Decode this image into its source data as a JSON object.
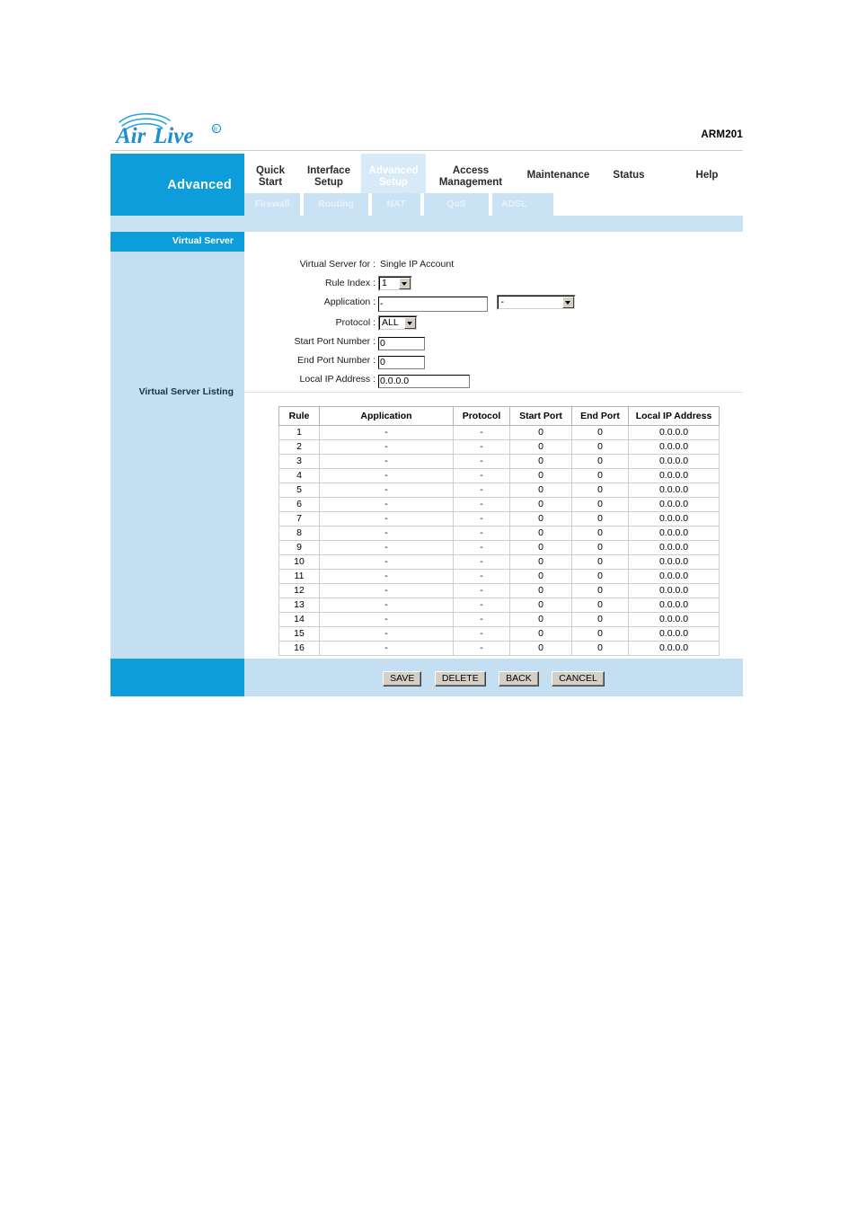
{
  "header": {
    "brand": "AirLive",
    "brand_mark": "®",
    "model": "ARM201"
  },
  "sidebar": {
    "section_title": "Advanced",
    "active_item": "Virtual Server",
    "listing_label": "Virtual Server Listing"
  },
  "nav": {
    "main_tabs": [
      {
        "label": "Quick\nStart",
        "active": false
      },
      {
        "label": "Interface\nSetup",
        "active": false
      },
      {
        "label": "Advanced\nSetup",
        "active": true
      },
      {
        "label": "Access\nManagement",
        "active": false
      },
      {
        "label": "Maintenance",
        "active": false
      },
      {
        "label": "Status",
        "active": false
      },
      {
        "label": "Help",
        "active": false
      }
    ],
    "sub_tabs": [
      {
        "label": "Firewall"
      },
      {
        "label": "Routing"
      },
      {
        "label": "NAT"
      },
      {
        "label": "QoS"
      },
      {
        "label": "ADSL"
      }
    ]
  },
  "form": {
    "virtual_server_for_label": "Virtual Server for :",
    "virtual_server_for_value": "Single IP Account",
    "rule_index_label": "Rule Index :",
    "rule_index_value": "1",
    "application_label": "Application :",
    "application_value": "-",
    "application_select_value": "-",
    "protocol_label": "Protocol :",
    "protocol_value": "ALL",
    "start_port_label": "Start Port Number :",
    "start_port_value": "0",
    "end_port_label": "End Port Number :",
    "end_port_value": "0",
    "local_ip_label": "Local IP Address :",
    "local_ip_value": "0.0.0.0"
  },
  "table": {
    "columns": [
      "Rule",
      "Application",
      "Protocol",
      "Start Port",
      "End Port",
      "Local IP Address"
    ],
    "rows": [
      [
        "1",
        "-",
        "-",
        "0",
        "0",
        "0.0.0.0"
      ],
      [
        "2",
        "-",
        "-",
        "0",
        "0",
        "0.0.0.0"
      ],
      [
        "3",
        "-",
        "-",
        "0",
        "0",
        "0.0.0.0"
      ],
      [
        "4",
        "-",
        "-",
        "0",
        "0",
        "0.0.0.0"
      ],
      [
        "5",
        "-",
        "-",
        "0",
        "0",
        "0.0.0.0"
      ],
      [
        "6",
        "-",
        "-",
        "0",
        "0",
        "0.0.0.0"
      ],
      [
        "7",
        "-",
        "-",
        "0",
        "0",
        "0.0.0.0"
      ],
      [
        "8",
        "-",
        "-",
        "0",
        "0",
        "0.0.0.0"
      ],
      [
        "9",
        "-",
        "-",
        "0",
        "0",
        "0.0.0.0"
      ],
      [
        "10",
        "-",
        "-",
        "0",
        "0",
        "0.0.0.0"
      ],
      [
        "11",
        "-",
        "-",
        "0",
        "0",
        "0.0.0.0"
      ],
      [
        "12",
        "-",
        "-",
        "0",
        "0",
        "0.0.0.0"
      ],
      [
        "13",
        "-",
        "-",
        "0",
        "0",
        "0.0.0.0"
      ],
      [
        "14",
        "-",
        "-",
        "0",
        "0",
        "0.0.0.0"
      ],
      [
        "15",
        "-",
        "-",
        "0",
        "0",
        "0.0.0.0"
      ],
      [
        "16",
        "-",
        "-",
        "0",
        "0",
        "0.0.0.0"
      ]
    ]
  },
  "buttons": [
    {
      "label": "SAVE"
    },
    {
      "label": "DELETE"
    },
    {
      "label": "BACK"
    },
    {
      "label": "CANCEL"
    }
  ],
  "colors": {
    "brand_blue": "#0d9ddb",
    "light_blue": "#c4dff1",
    "subtab_blue": "#c9e3f4",
    "active_tab_blue": "#d6eaf7"
  }
}
